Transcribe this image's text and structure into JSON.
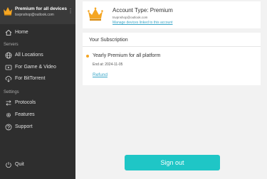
{
  "account": {
    "plan_header": "Premium for all devices",
    "email": "tsvpnshop@outlook.com"
  },
  "sidebar": {
    "home": "Home",
    "servers_section": "Servers",
    "all_locations": "All Locations",
    "game_video": "For Game & Video",
    "bittorrent": "For BitTorrent",
    "settings_section": "Settings",
    "protocols": "Protocols",
    "features": "Features",
    "support": "Support",
    "quit": "Quit"
  },
  "account_card": {
    "type_label": "Account Type: Premium",
    "email": "tsvpnshop@outlook.com",
    "manage_link": "Manage devices linked to this account"
  },
  "subscription": {
    "title": "Your Subscription",
    "plan_name": "Yearly Premium for all platform",
    "end_at": "End at: 2024-11-05",
    "refund": "Refund"
  },
  "signout_label": "Sign out",
  "colors": {
    "sidebar_bg": "#2e2e2e",
    "accent": "#1fc6c6",
    "link": "#3aa6c8",
    "crown": "#f5a623",
    "status_dot": "#f5a623"
  }
}
